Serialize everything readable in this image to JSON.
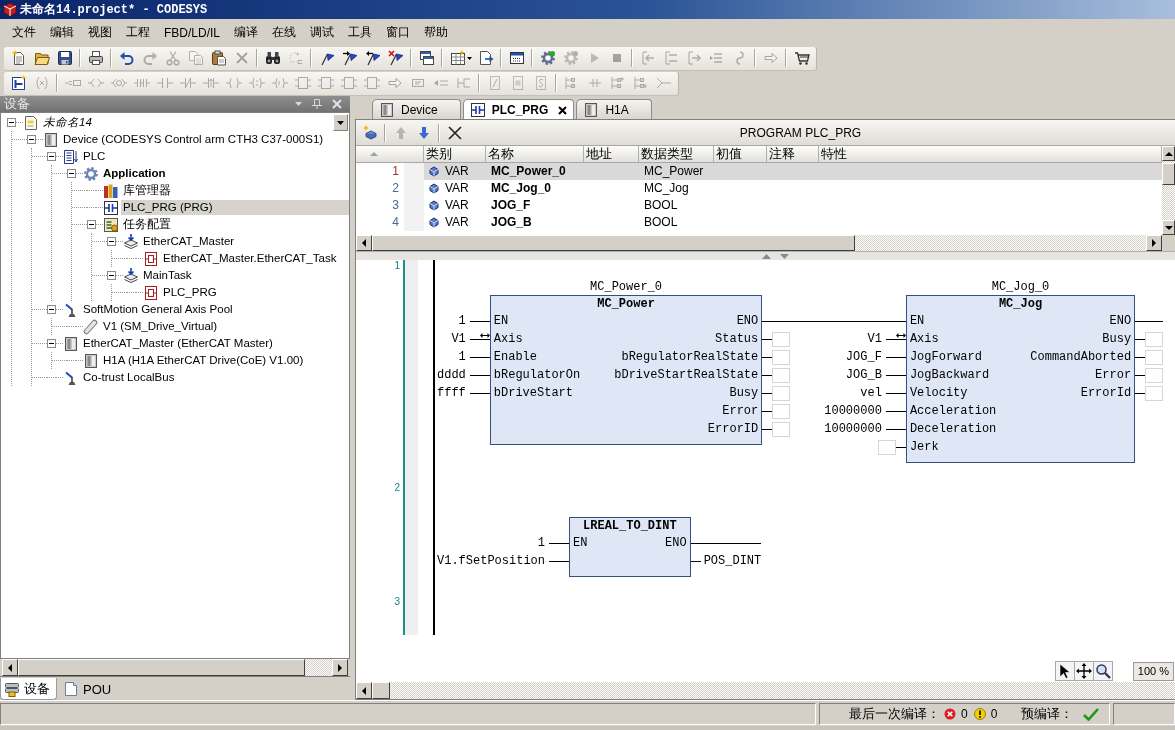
{
  "window": {
    "title": "未命名14.project* - CODESYS"
  },
  "menu": [
    "文件",
    "编辑",
    "视图",
    "工程",
    "FBD/LD/IL",
    "编译",
    "在线",
    "调试",
    "工具",
    "窗口",
    "帮助"
  ],
  "toolbars": [
    {
      "items": [
        {
          "kind": "new",
          "disabled": false
        },
        {
          "kind": "open",
          "disabled": false
        },
        {
          "kind": "save",
          "disabled": false
        },
        {
          "kind": "separator"
        },
        {
          "kind": "print",
          "disabled": false
        },
        {
          "kind": "separator"
        },
        {
          "kind": "undo",
          "disabled": false
        },
        {
          "kind": "redo",
          "disabled": true
        },
        {
          "kind": "cut",
          "disabled": true
        },
        {
          "kind": "copy",
          "disabled": true
        },
        {
          "kind": "paste",
          "disabled": false
        },
        {
          "kind": "delete",
          "disabled": true
        },
        {
          "kind": "separator"
        },
        {
          "kind": "find",
          "disabled": false
        },
        {
          "kind": "replace",
          "disabled": true
        },
        {
          "kind": "separator"
        },
        {
          "kind": "flag",
          "disabled": false
        },
        {
          "kind": "flag_next",
          "disabled": false
        },
        {
          "kind": "flag_prev",
          "disabled": false
        },
        {
          "kind": "flag_clear",
          "disabled": false
        },
        {
          "kind": "separator"
        },
        {
          "kind": "windows",
          "disabled": false
        },
        {
          "kind": "separator"
        },
        {
          "kind": "grid_menu",
          "disabled": false
        },
        {
          "kind": "export",
          "disabled": false
        },
        {
          "kind": "separator"
        },
        {
          "kind": "window",
          "disabled": false
        },
        {
          "kind": "separator"
        },
        {
          "kind": "gear_go",
          "disabled": false
        },
        {
          "kind": "gear_stop",
          "disabled": true
        },
        {
          "kind": "play",
          "disabled": true
        },
        {
          "kind": "stop",
          "disabled": true
        },
        {
          "kind": "separator"
        },
        {
          "kind": "step_over",
          "disabled": true
        },
        {
          "kind": "step_in",
          "disabled": true
        },
        {
          "kind": "step_out",
          "disabled": true
        },
        {
          "kind": "step_cursor",
          "disabled": true
        },
        {
          "kind": "step_next",
          "disabled": true
        },
        {
          "kind": "separator"
        },
        {
          "kind": "arrow",
          "disabled": true
        },
        {
          "kind": "separator"
        },
        {
          "kind": "cart",
          "disabled": false
        }
      ]
    },
    {
      "items": [
        {
          "kind": "network",
          "disabled": false
        },
        {
          "kind": "parens",
          "disabled": true
        },
        {
          "kind": "separator"
        },
        {
          "kind": "assign",
          "disabled": true
        },
        {
          "kind": "angle",
          "disabled": true
        },
        {
          "kind": "angle_circle",
          "disabled": true
        },
        {
          "kind": "contacts",
          "disabled": true
        },
        {
          "kind": "contact",
          "disabled": true
        },
        {
          "kind": "neg_contact",
          "disabled": true
        },
        {
          "kind": "contact_up",
          "disabled": true
        },
        {
          "kind": "coil",
          "disabled": true
        },
        {
          "kind": "coil_set",
          "disabled": true
        },
        {
          "kind": "coil_reset",
          "disabled": true
        },
        {
          "kind": "block",
          "disabled": true
        },
        {
          "kind": "block",
          "disabled": true
        },
        {
          "kind": "block",
          "disabled": true
        },
        {
          "kind": "block",
          "disabled": true
        },
        {
          "kind": "arrow",
          "disabled": true
        },
        {
          "kind": "label",
          "disabled": true
        },
        {
          "kind": "return",
          "disabled": true
        },
        {
          "kind": "branch",
          "disabled": true
        },
        {
          "kind": "separator"
        },
        {
          "kind": "slash_box",
          "disabled": true
        },
        {
          "kind": "fill_box",
          "disabled": true
        },
        {
          "kind": "curve_box",
          "disabled": true
        },
        {
          "kind": "separator"
        },
        {
          "kind": "tree_a",
          "disabled": true
        },
        {
          "kind": "tree_b",
          "disabled": true
        },
        {
          "kind": "tree_c",
          "disabled": true
        },
        {
          "kind": "tree_d",
          "disabled": true
        },
        {
          "kind": "tree_e",
          "disabled": true
        }
      ]
    }
  ],
  "devices_panel": {
    "title": "设备",
    "tree": [
      {
        "label": "未命名14",
        "kind": "project",
        "selected": false,
        "expanded": true,
        "children": [
          {
            "label": "Device (CODESYS Control arm CTH3 C37-000S1)",
            "kind": "device",
            "selected": false,
            "expanded": true,
            "children": [
              {
                "label": "PLC",
                "kind": "plc",
                "selected": false,
                "expanded": true,
                "children": [
                  {
                    "label": "Application",
                    "kind": "application",
                    "selected": false,
                    "expanded": true,
                    "children": [
                      {
                        "label": "库管理器",
                        "kind": "library",
                        "selected": false
                      },
                      {
                        "label": "PLC_PRG (PRG)",
                        "kind": "program",
                        "selected": true
                      },
                      {
                        "label": "任务配置",
                        "kind": "task_config",
                        "selected": false,
                        "expanded": true,
                        "children": [
                          {
                            "label": "EtherCAT_Master",
                            "kind": "task",
                            "selected": false,
                            "expanded": true,
                            "children": [
                              {
                                "label": "EtherCAT_Master.EtherCAT_Task",
                                "kind": "call",
                                "selected": false
                              }
                            ]
                          },
                          {
                            "label": "MainTask",
                            "kind": "task",
                            "selected": false,
                            "expanded": true,
                            "children": [
                              {
                                "label": "PLC_PRG",
                                "kind": "call",
                                "selected": false
                              }
                            ]
                          }
                        ]
                      }
                    ]
                  }
                ]
              },
              {
                "label": "SoftMotion General Axis Pool",
                "kind": "axis_pool",
                "selected": false,
                "expanded": true,
                "children": [
                  {
                    "label": "V1 (SM_Drive_Virtual)",
                    "kind": "drive",
                    "selected": false
                  }
                ]
              },
              {
                "label": "EtherCAT_Master (EtherCAT Master)",
                "kind": "device",
                "selected": false,
                "expanded": true,
                "children": [
                  {
                    "label": "H1A (H1A EtherCAT Drive(CoE) V1.00)",
                    "kind": "device",
                    "selected": false
                  }
                ]
              },
              {
                "label": "Co-trust LocalBus",
                "kind": "axis_pool",
                "selected": false
              }
            ]
          }
        ]
      }
    ],
    "tabs": [
      {
        "label": "设备",
        "kind": "devices",
        "selected": true
      },
      {
        "label": "POU",
        "kind": "pou",
        "selected": false
      }
    ]
  },
  "editor": {
    "tabs": [
      {
        "label": "Device",
        "kind": "device",
        "selected": false
      },
      {
        "label": "PLC_PRG",
        "kind": "program",
        "selected": true
      },
      {
        "label": "H1A",
        "kind": "device",
        "selected": false
      }
    ],
    "toolbar": [
      {
        "kind": "add",
        "disabled": false
      },
      {
        "kind": "separator"
      },
      {
        "kind": "up",
        "disabled": true
      },
      {
        "kind": "down",
        "disabled": false
      },
      {
        "kind": "separator"
      },
      {
        "kind": "delete",
        "disabled": false
      }
    ],
    "header": "PROGRAM PLC_PRG",
    "declarations": {
      "columns": [
        "类别",
        "名称",
        "地址",
        "数据类型",
        "初值",
        "注释",
        "特性"
      ],
      "rows": [
        {
          "line": "1",
          "class": "VAR",
          "name": "MC_Power_0",
          "type": "MC_Power",
          "selected": true
        },
        {
          "line": "2",
          "class": "VAR",
          "name": "MC_Jog_0",
          "type": "MC_Jog",
          "selected": false
        },
        {
          "line": "3",
          "class": "VAR",
          "name": "JOG_F",
          "type": "BOOL",
          "selected": false
        },
        {
          "line": "4",
          "class": "VAR",
          "name": "JOG_B",
          "type": "BOOL",
          "selected": false
        }
      ]
    },
    "fbd": {
      "networks": [
        {
          "number": "1",
          "blocks": [
            {
              "instance": "MC_Power_0",
              "type": "MC_Power",
              "inputs": [
                {
                  "pin": "EN",
                  "value": "1",
                  "wire": false,
                  "in_out": false
                },
                {
                  "pin": "Axis",
                  "value": "V1",
                  "wire": false,
                  "in_out": true
                },
                {
                  "pin": "Enable",
                  "value": "1",
                  "wire": false,
                  "in_out": false
                },
                {
                  "pin": "bRegulatorOn",
                  "value": "dddd",
                  "wire": false,
                  "in_out": false
                },
                {
                  "pin": "bDriveStart",
                  "value": "ffff",
                  "wire": false,
                  "in_out": false
                }
              ],
              "outputs": [
                {
                  "pin": "ENO",
                  "wire": true
                },
                {
                  "pin": "Status",
                  "wire": false
                },
                {
                  "pin": "bRegulatorRealState",
                  "wire": false
                },
                {
                  "pin": "bDriveStartRealState",
                  "wire": false
                },
                {
                  "pin": "Busy",
                  "wire": false
                },
                {
                  "pin": "Error",
                  "wire": false
                },
                {
                  "pin": "ErrorID",
                  "wire": false
                }
              ]
            },
            {
              "instance": "MC_Jog_0",
              "type": "MC_Jog",
              "inputs": [
                {
                  "pin": "EN",
                  "wire": true,
                  "in_out": false
                },
                {
                  "pin": "Axis",
                  "value": "V1",
                  "wire": false,
                  "in_out": true
                },
                {
                  "pin": "JogForward",
                  "value": "JOG_F",
                  "wire": false,
                  "in_out": false
                },
                {
                  "pin": "JogBackward",
                  "value": "JOG_B",
                  "wire": false,
                  "in_out": false
                },
                {
                  "pin": "Velocity",
                  "value": "vel",
                  "wire": false,
                  "in_out": false
                },
                {
                  "pin": "Acceleration",
                  "value": "10000000",
                  "wire": false,
                  "in_out": false
                },
                {
                  "pin": "Deceleration",
                  "value": "10000000",
                  "wire": false,
                  "in_out": false
                },
                {
                  "pin": "Jerk",
                  "wire": false,
                  "in_out": false
                }
              ],
              "outputs": [
                {
                  "pin": "ENO",
                  "wire": true
                },
                {
                  "pin": "Busy",
                  "wire": false
                },
                {
                  "pin": "CommandAborted",
                  "wire": false
                },
                {
                  "pin": "Error",
                  "wire": false
                },
                {
                  "pin": "ErrorId",
                  "wire": false
                }
              ]
            }
          ]
        },
        {
          "number": "2",
          "blocks": [
            {
              "type": "LREAL_TO_DINT",
              "inputs": [
                {
                  "pin": "EN",
                  "value": "1",
                  "wire": false,
                  "in_out": false
                },
                {
                  "value": "V1.fSetPosition",
                  "wire": false,
                  "in_out": false
                }
              ],
              "outputs": [
                {
                  "pin": "ENO",
                  "wire": true
                },
                {
                  "value": "POS_DINT",
                  "wire": false
                }
              ]
            }
          ]
        },
        {
          "number": "3"
        }
      ]
    },
    "zoom": "100 %"
  },
  "status_bar": {
    "last_build_label": "最后一次编译：",
    "errors": "0",
    "warnings": "0",
    "precompile_label": "预编译：",
    "precompile_ok": true
  }
}
